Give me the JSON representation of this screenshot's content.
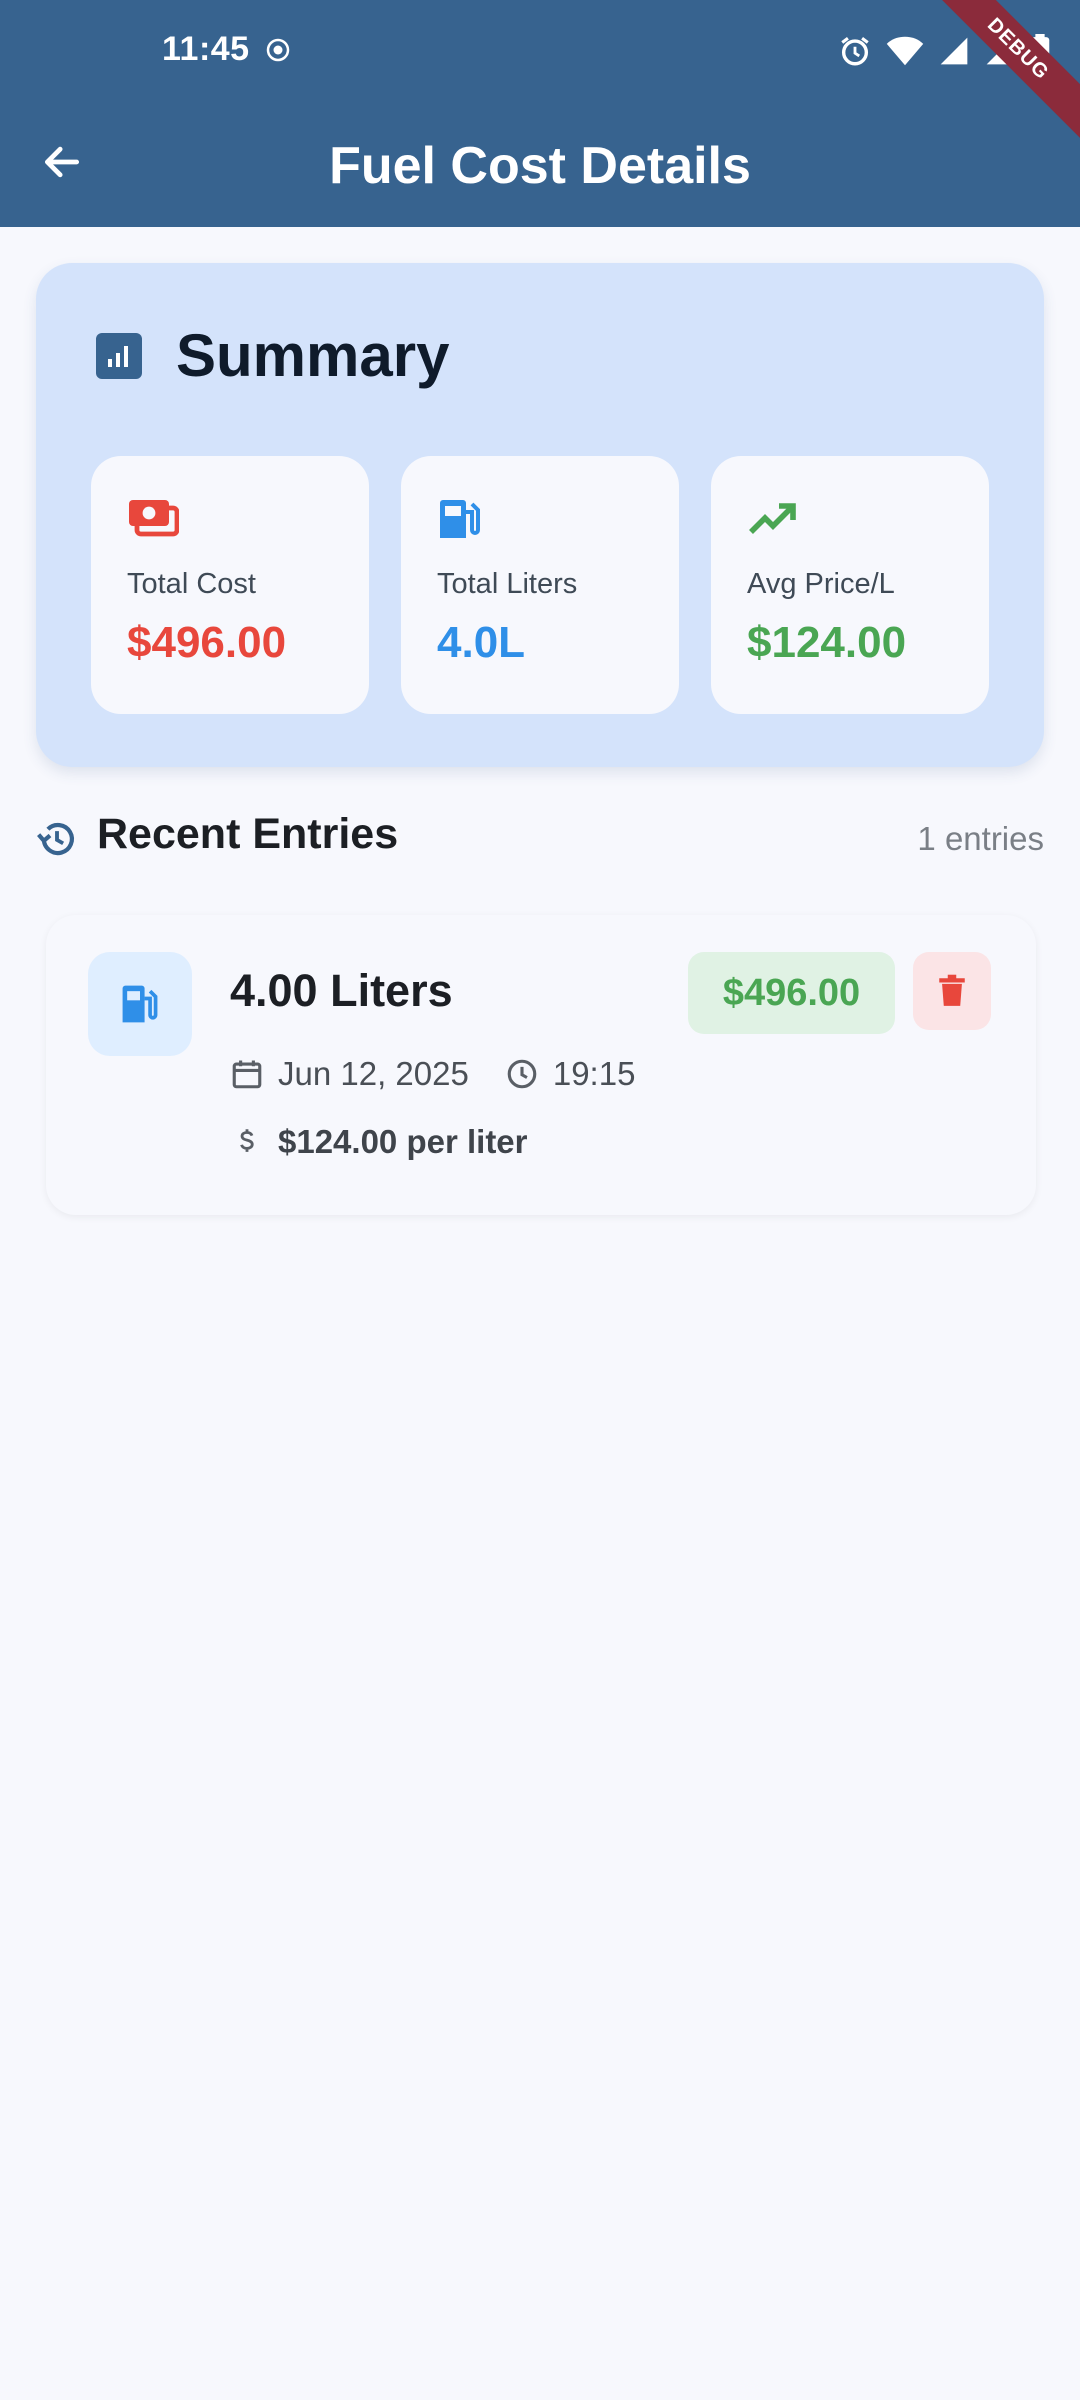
{
  "status_bar": {
    "time": "11:45",
    "icons": [
      "alarm-icon",
      "wifi-icon",
      "signal-icon",
      "signal-icon",
      "battery-icon"
    ],
    "debug_label": "DEBUG"
  },
  "app_bar": {
    "title": "Fuel Cost Details",
    "back_icon": "arrow-back-icon",
    "color": "#37638f"
  },
  "summary": {
    "title": "Summary",
    "icon": "bar-chart-icon",
    "stats": [
      {
        "label": "Total Cost",
        "value": "$496.00",
        "icon": "money-icon",
        "color": "#e8473c"
      },
      {
        "label": "Total Liters",
        "value": "4.0L",
        "icon": "fuel-pump-icon",
        "color": "#2f8fe8"
      },
      {
        "label": "Avg Price/L",
        "value": "$124.00",
        "icon": "trending-up-icon",
        "color": "#4aa653"
      }
    ]
  },
  "recent": {
    "title": "Recent Entries",
    "count": "1 entries",
    "icon": "history-icon",
    "entries": [
      {
        "title": "4.00 Liters",
        "amount": "$496.00",
        "date": "Jun 12, 2025",
        "time": "19:15",
        "price_per_liter": "$124.00 per liter"
      }
    ]
  }
}
